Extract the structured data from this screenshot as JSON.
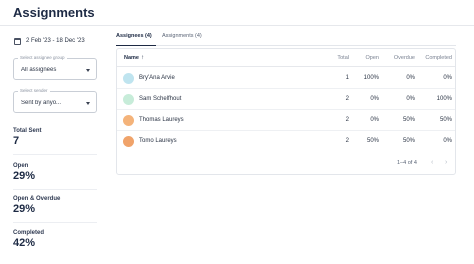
{
  "page": {
    "title": "Assignments"
  },
  "filters": {
    "date_range": "2 Feb '23 - 18 Dec '23",
    "assignee_group": {
      "label": "Select assignee group",
      "value": "All assignees"
    },
    "sender": {
      "label": "Select sender",
      "value": "Sent by anyo..."
    }
  },
  "stats": [
    {
      "label": "Total Sent",
      "value": "7"
    },
    {
      "label": "Open",
      "value": "29%"
    },
    {
      "label": "Open & Overdue",
      "value": "29%"
    },
    {
      "label": "Completed",
      "value": "42%"
    }
  ],
  "tabs": [
    {
      "label": "Assignees (4)",
      "active": true
    },
    {
      "label": "Assignments (4)",
      "active": false
    }
  ],
  "table": {
    "columns": [
      "Name",
      "Total",
      "Open",
      "Overdue",
      "Completed"
    ],
    "sort_indicator": "↑",
    "rows": [
      {
        "name": "Bry'Ana Arvie",
        "total": "1",
        "open": "100%",
        "overdue": "0%",
        "completed": "0%",
        "avatar_color": "#bfe4ef"
      },
      {
        "name": "Sam Schelfhout",
        "total": "2",
        "open": "0%",
        "overdue": "0%",
        "completed": "100%",
        "avatar_color": "#c7ecd9"
      },
      {
        "name": "Thomas Laureys",
        "total": "2",
        "open": "0%",
        "overdue": "50%",
        "completed": "50%",
        "avatar_color": "#f4b37a"
      },
      {
        "name": "Tomo Laureys",
        "total": "2",
        "open": "50%",
        "overdue": "50%",
        "completed": "0%",
        "avatar_color": "#f0a36a"
      }
    ],
    "pagination": "1–4 of 4",
    "prev_icon": "‹",
    "next_icon": "›"
  }
}
